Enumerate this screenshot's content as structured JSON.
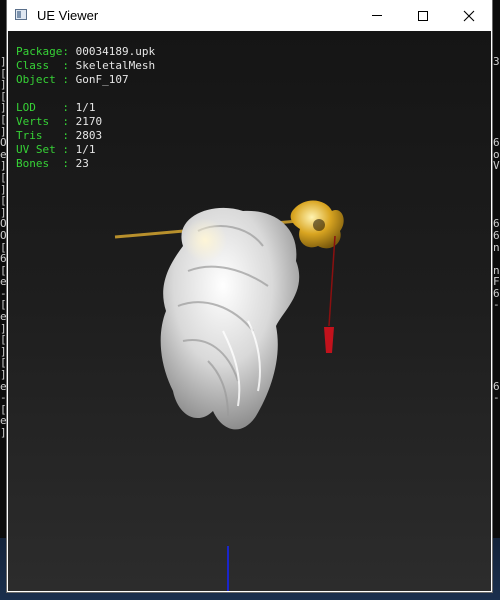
{
  "window": {
    "title": "UE Viewer"
  },
  "info": {
    "package": {
      "key": "Package",
      "value": "00034189.upk"
    },
    "class": {
      "key": "Class  ",
      "value": "SkeletalMesh"
    },
    "object": {
      "key": "Object ",
      "value": "GonF_107"
    },
    "lod": {
      "key": "LOD    ",
      "value": "1/1"
    },
    "verts": {
      "key": "Verts  ",
      "value": "2170"
    },
    "tris": {
      "key": "Tris   ",
      "value": "2803"
    },
    "uvset": {
      "key": "UV Set ",
      "value": "1/1"
    },
    "bones": {
      "key": "Bones  ",
      "value": "23"
    }
  },
  "background_console": {
    "left_chars": [
      "]",
      "[",
      "]",
      "[",
      "]",
      "[",
      "]",
      "O",
      "e",
      "]",
      "[",
      "]",
      "[",
      "]",
      "O",
      "O",
      "[",
      "6",
      "[",
      "e",
      "-",
      "[",
      "e",
      "]",
      "[",
      "]",
      "[",
      "]",
      "e",
      "-",
      "[",
      "e",
      "]"
    ],
    "right_chars": [
      "3",
      "",
      "",
      "",
      "",
      "",
      "",
      "6",
      "o",
      "V",
      "",
      "",
      "",
      "",
      "6",
      "6",
      "n",
      "",
      "n",
      "F",
      "6",
      "-",
      "",
      "",
      "",
      "",
      "",
      "",
      "6",
      "-",
      "",
      "",
      ""
    ]
  },
  "colors": {
    "label": "#36d236",
    "value": "#e6e6e6",
    "axis": "#1a25c9"
  }
}
